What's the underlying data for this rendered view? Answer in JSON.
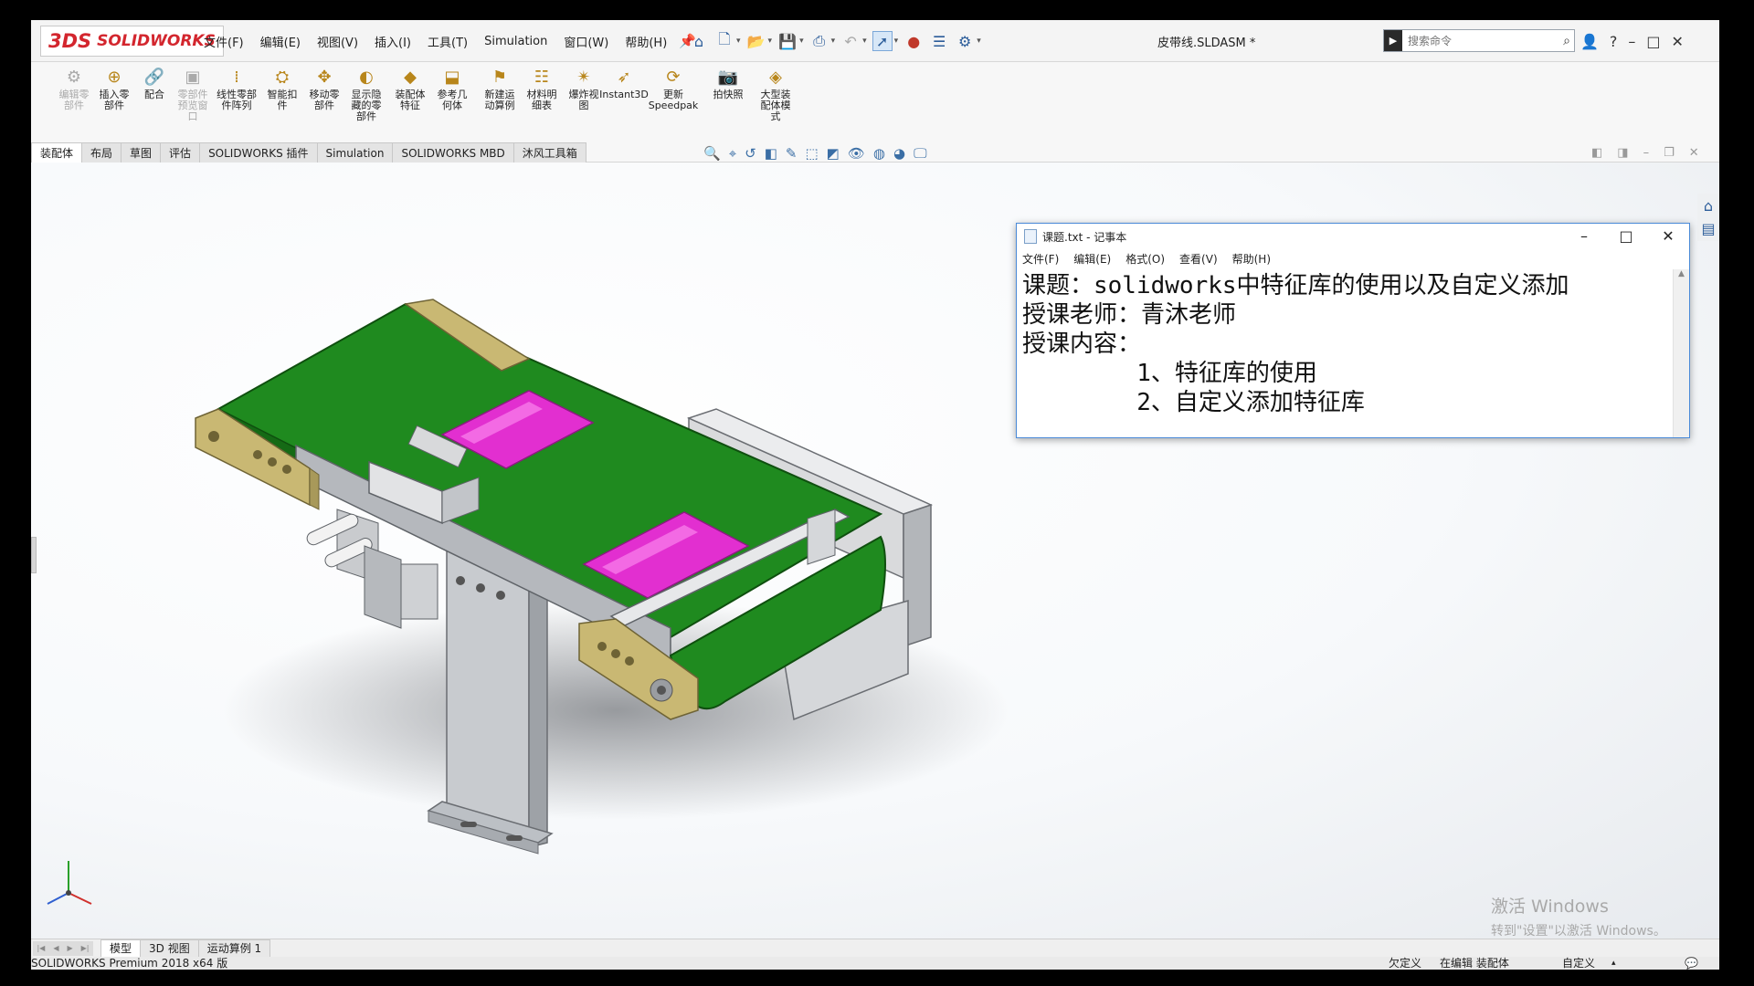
{
  "app": {
    "logo_text": "SOLIDWORKS",
    "logo_mark": "3DS",
    "document_title": "皮带线.SLDASM *"
  },
  "menu": {
    "items": [
      "文件(F)",
      "编辑(E)",
      "视图(V)",
      "插入(I)",
      "工具(T)",
      "Simulation",
      "窗口(W)",
      "帮助(H)"
    ]
  },
  "search": {
    "placeholder": "搜索命令"
  },
  "ribbon": {
    "buttons": [
      {
        "label": "编辑零\n部件",
        "icon": "edit-component-icon",
        "disabled": true
      },
      {
        "label": "插入零\n部件",
        "icon": "insert-component-icon",
        "disabled": false
      },
      {
        "label": "配合",
        "icon": "mate-icon",
        "disabled": false
      },
      {
        "label": "零部件\n预览窗\n口",
        "icon": "component-preview-icon",
        "disabled": true
      },
      {
        "label": "线性零部\n件阵列",
        "icon": "linear-pattern-icon",
        "disabled": false
      },
      {
        "label": "智能扣\n件",
        "icon": "smart-fasteners-icon",
        "disabled": false
      },
      {
        "label": "移动零\n部件",
        "icon": "move-component-icon",
        "disabled": false
      },
      {
        "label": "显示隐\n藏的零\n部件",
        "icon": "show-hidden-icon",
        "disabled": false
      },
      {
        "label": "装配体\n特征",
        "icon": "assembly-features-icon",
        "disabled": false
      },
      {
        "label": "参考几\n何体",
        "icon": "reference-geometry-icon",
        "disabled": false
      },
      {
        "label": "新建运\n动算例",
        "icon": "new-motion-study-icon",
        "disabled": false
      },
      {
        "label": "材料明\n细表",
        "icon": "bill-of-materials-icon",
        "disabled": false
      },
      {
        "label": "爆炸视\n图",
        "icon": "exploded-view-icon",
        "disabled": false
      },
      {
        "label": "Instant3D",
        "icon": "instant3d-icon",
        "disabled": false
      },
      {
        "label": "更新\nSpeedpak",
        "icon": "speedpak-icon",
        "disabled": false
      },
      {
        "label": "拍快照",
        "icon": "snapshot-icon",
        "disabled": false
      },
      {
        "label": "大型装\n配体模\n式",
        "icon": "large-assembly-icon",
        "disabled": false
      }
    ]
  },
  "command_tabs": [
    "装配体",
    "布局",
    "草图",
    "评估",
    "SOLIDWORKS 插件",
    "Simulation",
    "SOLIDWORKS MBD",
    "沐风工具箱"
  ],
  "notepad": {
    "title": "课题.txt - 记事本",
    "menu": [
      "文件(F)",
      "编辑(E)",
      "格式(O)",
      "查看(V)",
      "帮助(H)"
    ],
    "lines": [
      "课题：solidworks中特征库的使用以及自定义添加",
      "授课老师：青沐老师",
      "授课内容：",
      "        1、特征库的使用",
      "        2、自定义添加特征库"
    ]
  },
  "bottom_tabs": [
    "模型",
    "3D 视图",
    "运动算例 1"
  ],
  "statusbar": {
    "left": "SOLIDWORKS Premium 2018 x64 版",
    "under_defined": "欠定义",
    "editing": "在编辑 装配体",
    "custom": "自定义"
  },
  "watermark": {
    "line1": "激活 Windows",
    "line2": "转到\"设置\"以激活 Windows。"
  },
  "colors": {
    "belt": "#1f8a1f",
    "pink_part": "#e22fd0",
    "end_plate": "#c9b873",
    "frame": "#c6c6c6",
    "notepad_border": "#4a8ad8",
    "logo_red": "#d3262e"
  }
}
